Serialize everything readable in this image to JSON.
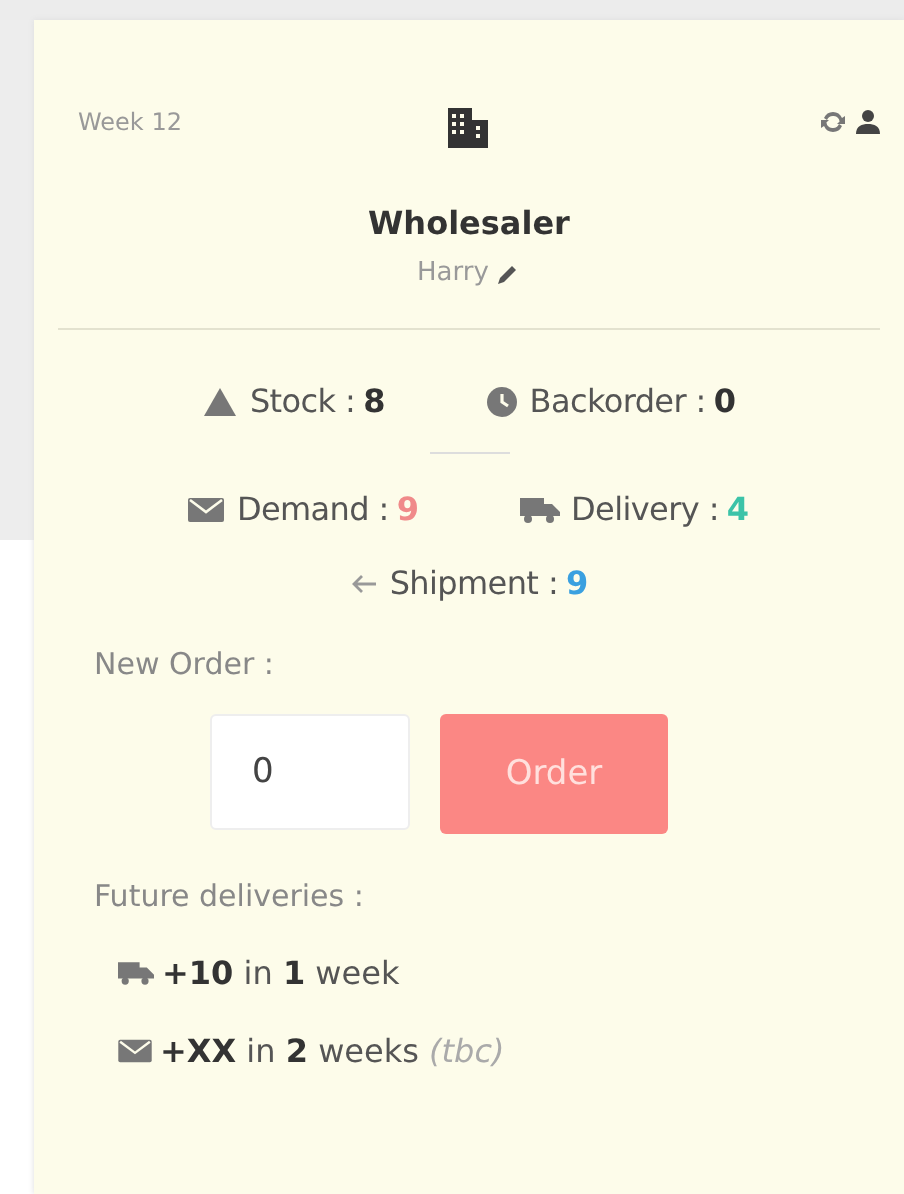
{
  "header": {
    "week": "Week 12",
    "role": "Wholesaler",
    "player": "Harry"
  },
  "stats": [
    {
      "kind": "stock",
      "label": "Stock :",
      "value": "8",
      "color": "#333333"
    },
    {
      "kind": "backorder",
      "label": "Backorder :",
      "value": "0",
      "color": "#333333"
    },
    {
      "kind": "demand",
      "label": "Demand :",
      "value": "9",
      "color": "#f08a8a"
    },
    {
      "kind": "delivery",
      "label": "Delivery :",
      "value": "4",
      "color": "#3cc3a8"
    },
    {
      "kind": "shipment",
      "label": "Shipment :",
      "value": "9",
      "color": "#3aa0e0"
    }
  ],
  "new_order": {
    "label": "New Order :",
    "value": "0",
    "button": "Order"
  },
  "future": {
    "label": "Future deliveries :",
    "items": [
      {
        "kind": "truck",
        "text": "**+10** in **1** week"
      },
      {
        "kind": "envelope",
        "text": "**+XX** in **2** weeks *(tbc)*"
      }
    ]
  }
}
